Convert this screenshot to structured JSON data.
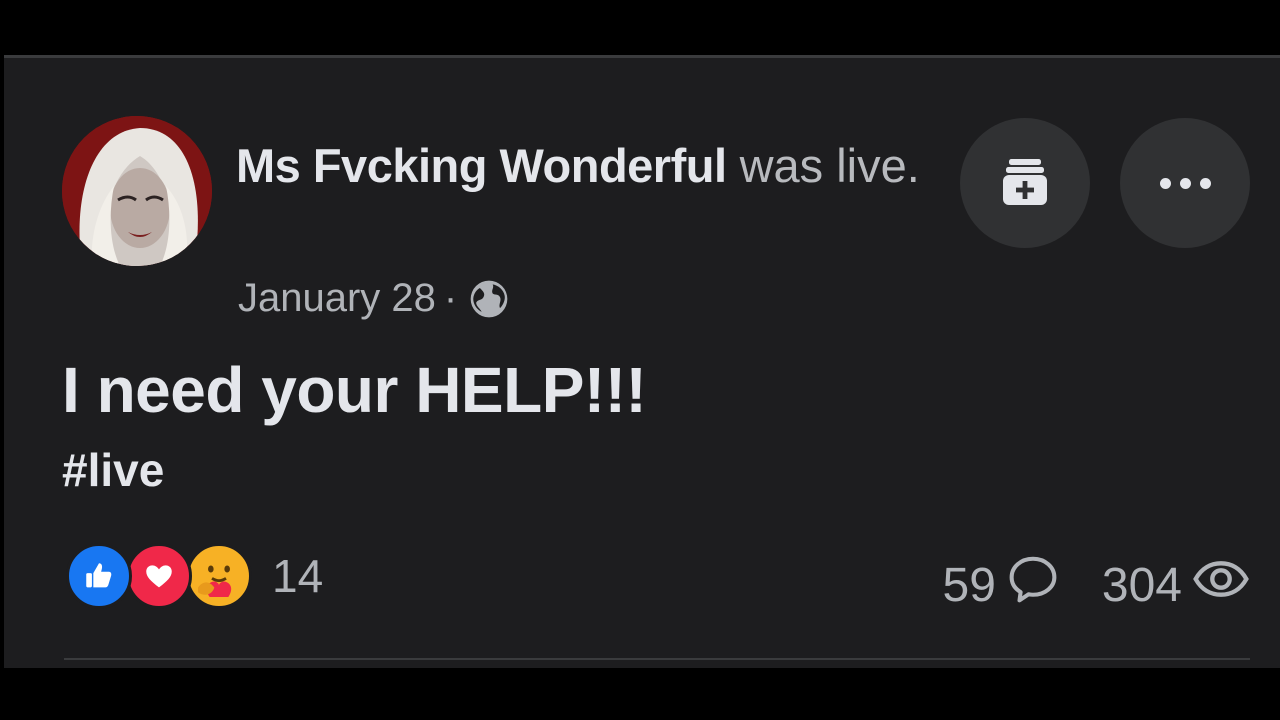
{
  "post": {
    "author_name": "Ms Fvcking Wonderful",
    "action_text": "was live.",
    "date": "January 28",
    "separator": "·",
    "audience_icon": "globe-icon",
    "message": "I need your HELP!!!",
    "hashtag": "#live"
  },
  "header_actions": [
    {
      "name": "save-post-button",
      "icon": "save-bookmark-plus-icon"
    },
    {
      "name": "more-options-button",
      "icon": "more-horizontal-icon"
    }
  ],
  "reactions": {
    "types": [
      "like",
      "love",
      "care"
    ],
    "count": "14"
  },
  "stats": {
    "comments": "59",
    "comments_icon": "comment-bubble-icon",
    "views": "304",
    "views_icon": "eye-icon"
  },
  "colors": {
    "card_background": "#1d1d1f",
    "page_background": "#000000",
    "primary_text": "#e4e6eb",
    "secondary_text": "#b0b3b8",
    "button_background": "#303133",
    "like_blue": "#1877f2",
    "love_red": "#f02849",
    "care_yellow": "#f7b125"
  }
}
